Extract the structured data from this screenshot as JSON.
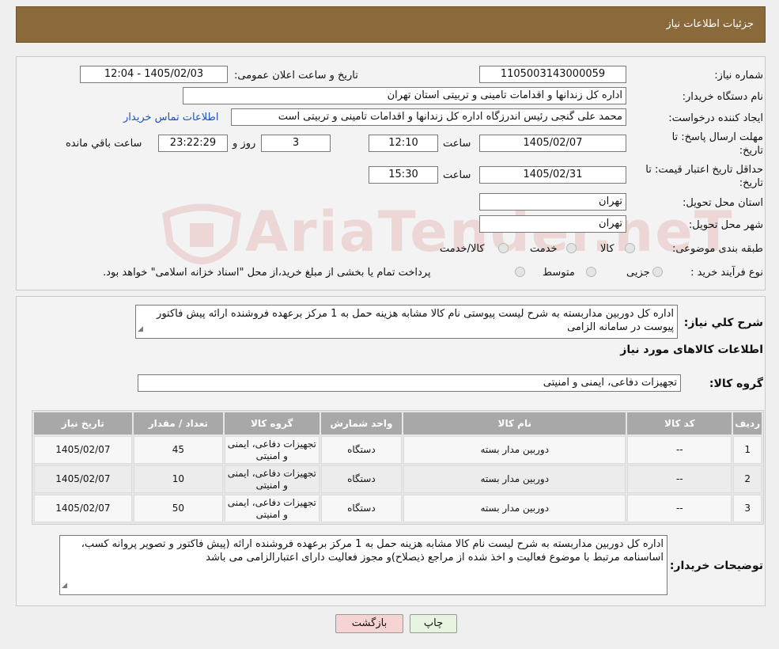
{
  "header": {
    "title": "جزئیات اطلاعات نیاز"
  },
  "form": {
    "need_number": {
      "label": "شماره نیاز:",
      "value": "1105003143000059"
    },
    "announce": {
      "label": "تاریخ و ساعت اعلان عمومی:",
      "value": "1405/02/03 - 12:04"
    },
    "buyer": {
      "label": "نام دستگاه خریدار:",
      "value": "اداره کل زندانها و اقدامات تامینی و تربیتی استان تهران"
    },
    "creator": {
      "label": "ایجاد کننده درخواست:",
      "value": "محمد علی گنجی رئیس اندرزگاه  اداره کل زندانها و اقدامات تامینی و تربیتی است",
      "contact_link": "اطلاعات تماس خریدار"
    },
    "deadline": {
      "label": "مهلت ارسال پاسخ: تا تاریخ:",
      "date": "1405/02/07",
      "time_label": "ساعت",
      "time": "12:10",
      "days": "3",
      "days_label": "روز و",
      "remaining": "23:22:29",
      "remaining_label": "ساعت باقي مانده"
    },
    "validity": {
      "label": "حداقل تاریخ اعتبار قیمت: تا تاریخ:",
      "date": "1405/02/31",
      "time_label": "ساعت",
      "time": "15:30"
    },
    "province": {
      "label": "استان محل تحویل:",
      "value": "تهران"
    },
    "city": {
      "label": "شهر محل تحویل:",
      "value": "تهران"
    },
    "category": {
      "label": "طبقه بندی موضوعی:",
      "options": [
        "کالا",
        "خدمت",
        "کالا/خدمت"
      ]
    },
    "process": {
      "label": "نوع فرآیند خرید :",
      "options": [
        "جزیی",
        "متوسط"
      ],
      "note": "پرداخت تمام یا بخشی از مبلغ خرید،از محل \"اسناد خزانه اسلامی\" خواهد بود."
    }
  },
  "summary": {
    "label": "شرح کلي نياز:",
    "text": "اداره کل دوربین مداربسته به شرح لیست پیوستی نام کالا مشابه هزینه حمل به 1 مرکز برعهده فروشنده ارائه پیش فاکتور  پیوست در سامانه الزامی"
  },
  "goods_title": "اطلاعات کالاهای مورد نیاز",
  "group": {
    "label": "گروه کالا:",
    "value": "تجهیزات دفاعی، ایمنی و امنیتی"
  },
  "table": {
    "headers": [
      "ردیف",
      "کد کالا",
      "نام کالا",
      "واحد شمارش",
      "گروه کالا",
      "تعداد / مقدار",
      "تاریخ نیاز"
    ],
    "rows": [
      [
        "1",
        "--",
        "دوربین مدار بسته",
        "دستگاه",
        "تجهیزات دفاعی، ایمنی و امنیتی",
        "45",
        "1405/02/07"
      ],
      [
        "2",
        "--",
        "دوربین مدار بسته",
        "دستگاه",
        "تجهیزات دفاعی، ایمنی و امنیتی",
        "10",
        "1405/02/07"
      ],
      [
        "3",
        "--",
        "دوربین مدار بسته",
        "دستگاه",
        "تجهیزات دفاعی، ایمنی و امنیتی",
        "50",
        "1405/02/07"
      ]
    ]
  },
  "buyer_notes": {
    "label": "توضیحات خریدار:",
    "text": "اداره کل دوربین مداربسته به شرح لیست نام کالا مشابه هزینه حمل  به 1 مرکز برعهده فروشنده ارائه (پیش فاکتور و  تصویر پروانه کسب، اساسنامه مرتبط با موضوع فعالیت و اخذ شده از مراجع ذیصلاح)و مجوز فعالیت دارای اعتبارالزامی می باشد"
  },
  "buttons": {
    "print": "چاپ",
    "back": "بازگشت"
  },
  "colors": {
    "header_bg": "#8a6a3a",
    "table_header_bg": "#a8a8a8",
    "link": "#1a4fc4",
    "back_button_bg": "#f7d4d4",
    "print_button_bg": "#e6f4e0"
  }
}
